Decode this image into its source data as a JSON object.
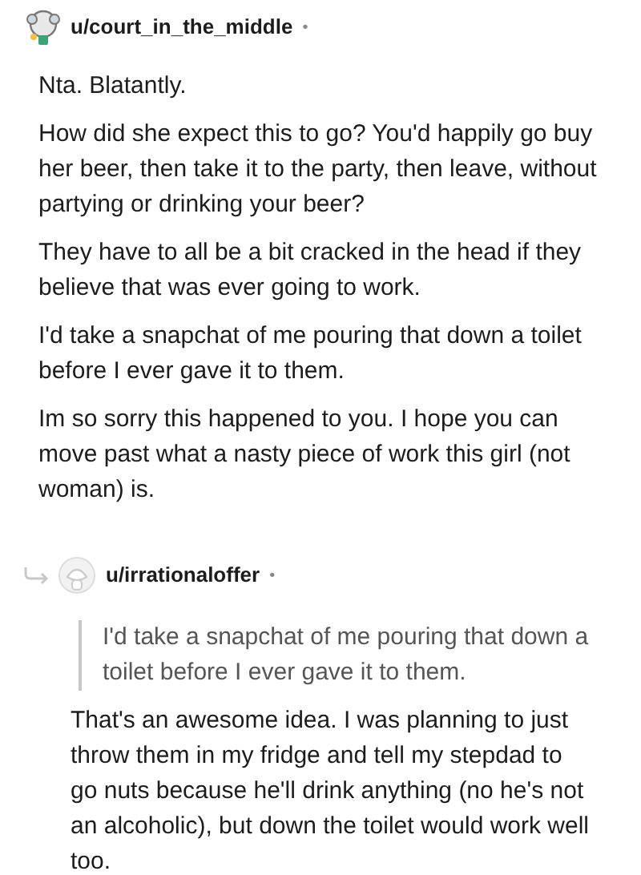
{
  "comment": {
    "username": "u/court_in_the_middle",
    "separator": "•",
    "paragraphs": [
      "Nta. Blatantly.",
      "How did she expect this to go? You'd happily go buy her beer, then take it to the party, then leave, without partying or drinking your beer?",
      "They have to all be a bit cracked in the head if they believe that was ever going to work.",
      "I'd take a snapchat of me pouring that down a toilet before I ever gave it to them.",
      "Im so sorry this happened to you. I hope you can move past what a nasty piece of work this girl (not woman) is."
    ]
  },
  "reply": {
    "username": "u/irrationaloffer",
    "separator": "•",
    "quote": "I'd take a snapchat of me pouring that down a toilet before I ever gave it to them.",
    "paragraphs": [
      "That's an awesome idea. I was planning to just throw them in my fridge and tell my stepdad to go nuts because he'll drink anything (no he's not an alcoholic), but down the toilet would work well too."
    ]
  }
}
